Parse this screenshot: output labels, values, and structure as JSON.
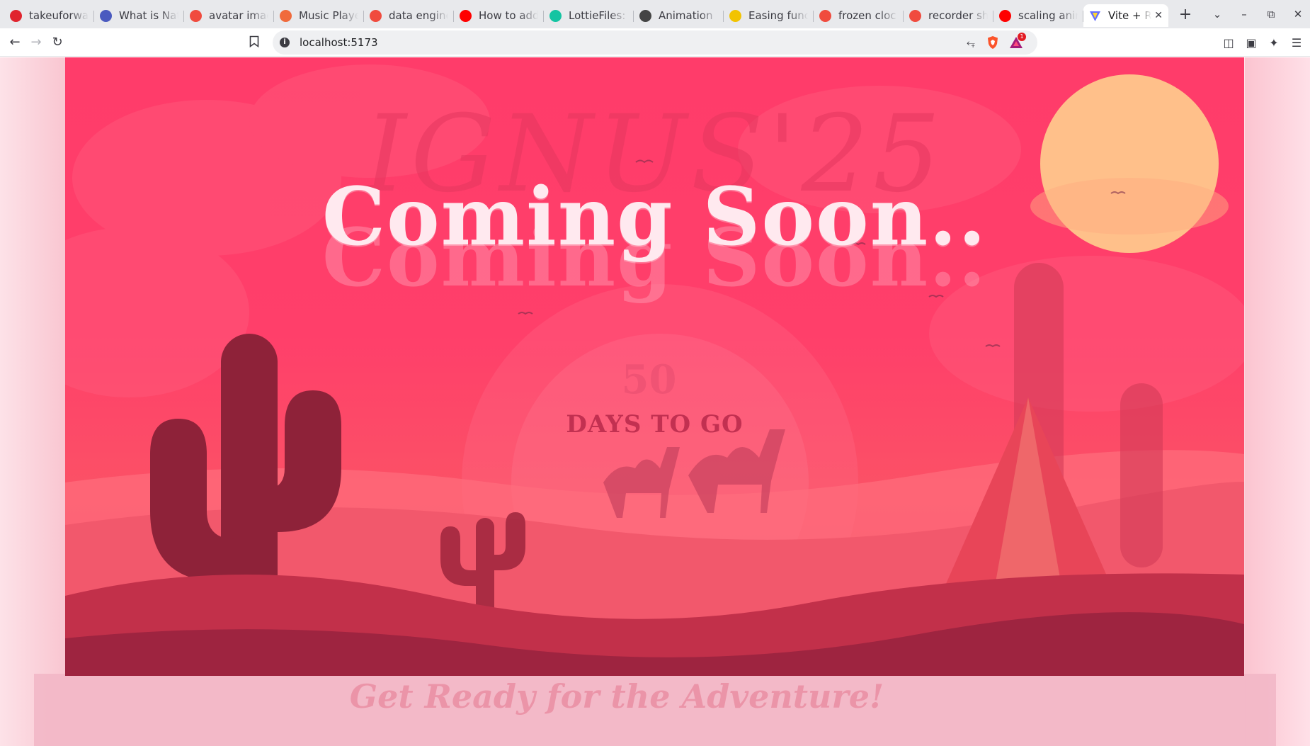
{
  "browser": {
    "tabs": [
      {
        "title": "takeuforward",
        "icon": "tuf-icon",
        "color": "#e0242e"
      },
      {
        "title": "What is Nat",
        "icon": "trend-chart-icon",
        "color": "#4a5abf"
      },
      {
        "title": "avatar imag",
        "icon": "brave-search-icon",
        "color": "#f04b3e"
      },
      {
        "title": "Music Playe",
        "icon": "asterisk-icon",
        "color": "#f06a3b"
      },
      {
        "title": "data engine",
        "icon": "brave-search-icon",
        "color": "#f04b3e"
      },
      {
        "title": "How to add",
        "icon": "youtube-icon",
        "color": "#ff0000"
      },
      {
        "title": "LottieFiles:",
        "icon": "lottiefiles-icon",
        "color": "#14c4a2"
      },
      {
        "title": "Animation",
        "icon": "openai-icon",
        "color": "#444444"
      },
      {
        "title": "Easing func",
        "icon": "easing-icon",
        "color": "#f2c300"
      },
      {
        "title": "frozen cloc",
        "icon": "brave-search-icon",
        "color": "#f04b3e"
      },
      {
        "title": "recorder sh",
        "icon": "brave-search-icon",
        "color": "#f04b3e"
      },
      {
        "title": "scaling anim",
        "icon": "youtube-icon",
        "color": "#ff0000"
      }
    ],
    "active_tab": {
      "title": "Vite + React",
      "icon": "vite-icon"
    },
    "address": "localhost:5173",
    "rewards_badge": "1"
  },
  "page": {
    "ghost_title": "IGNUS'25",
    "headline": "Coming Soon..",
    "countdown": "50",
    "countdown_label": "DAYS TO GO",
    "tagline": "Get Ready for the Adventure!"
  },
  "colors": {
    "sky": "#ff3c6a",
    "sun": "#ffc08a",
    "cactus": "#8e2239",
    "dune_dark": "#9e2440",
    "accent": "#ffe9ef"
  }
}
